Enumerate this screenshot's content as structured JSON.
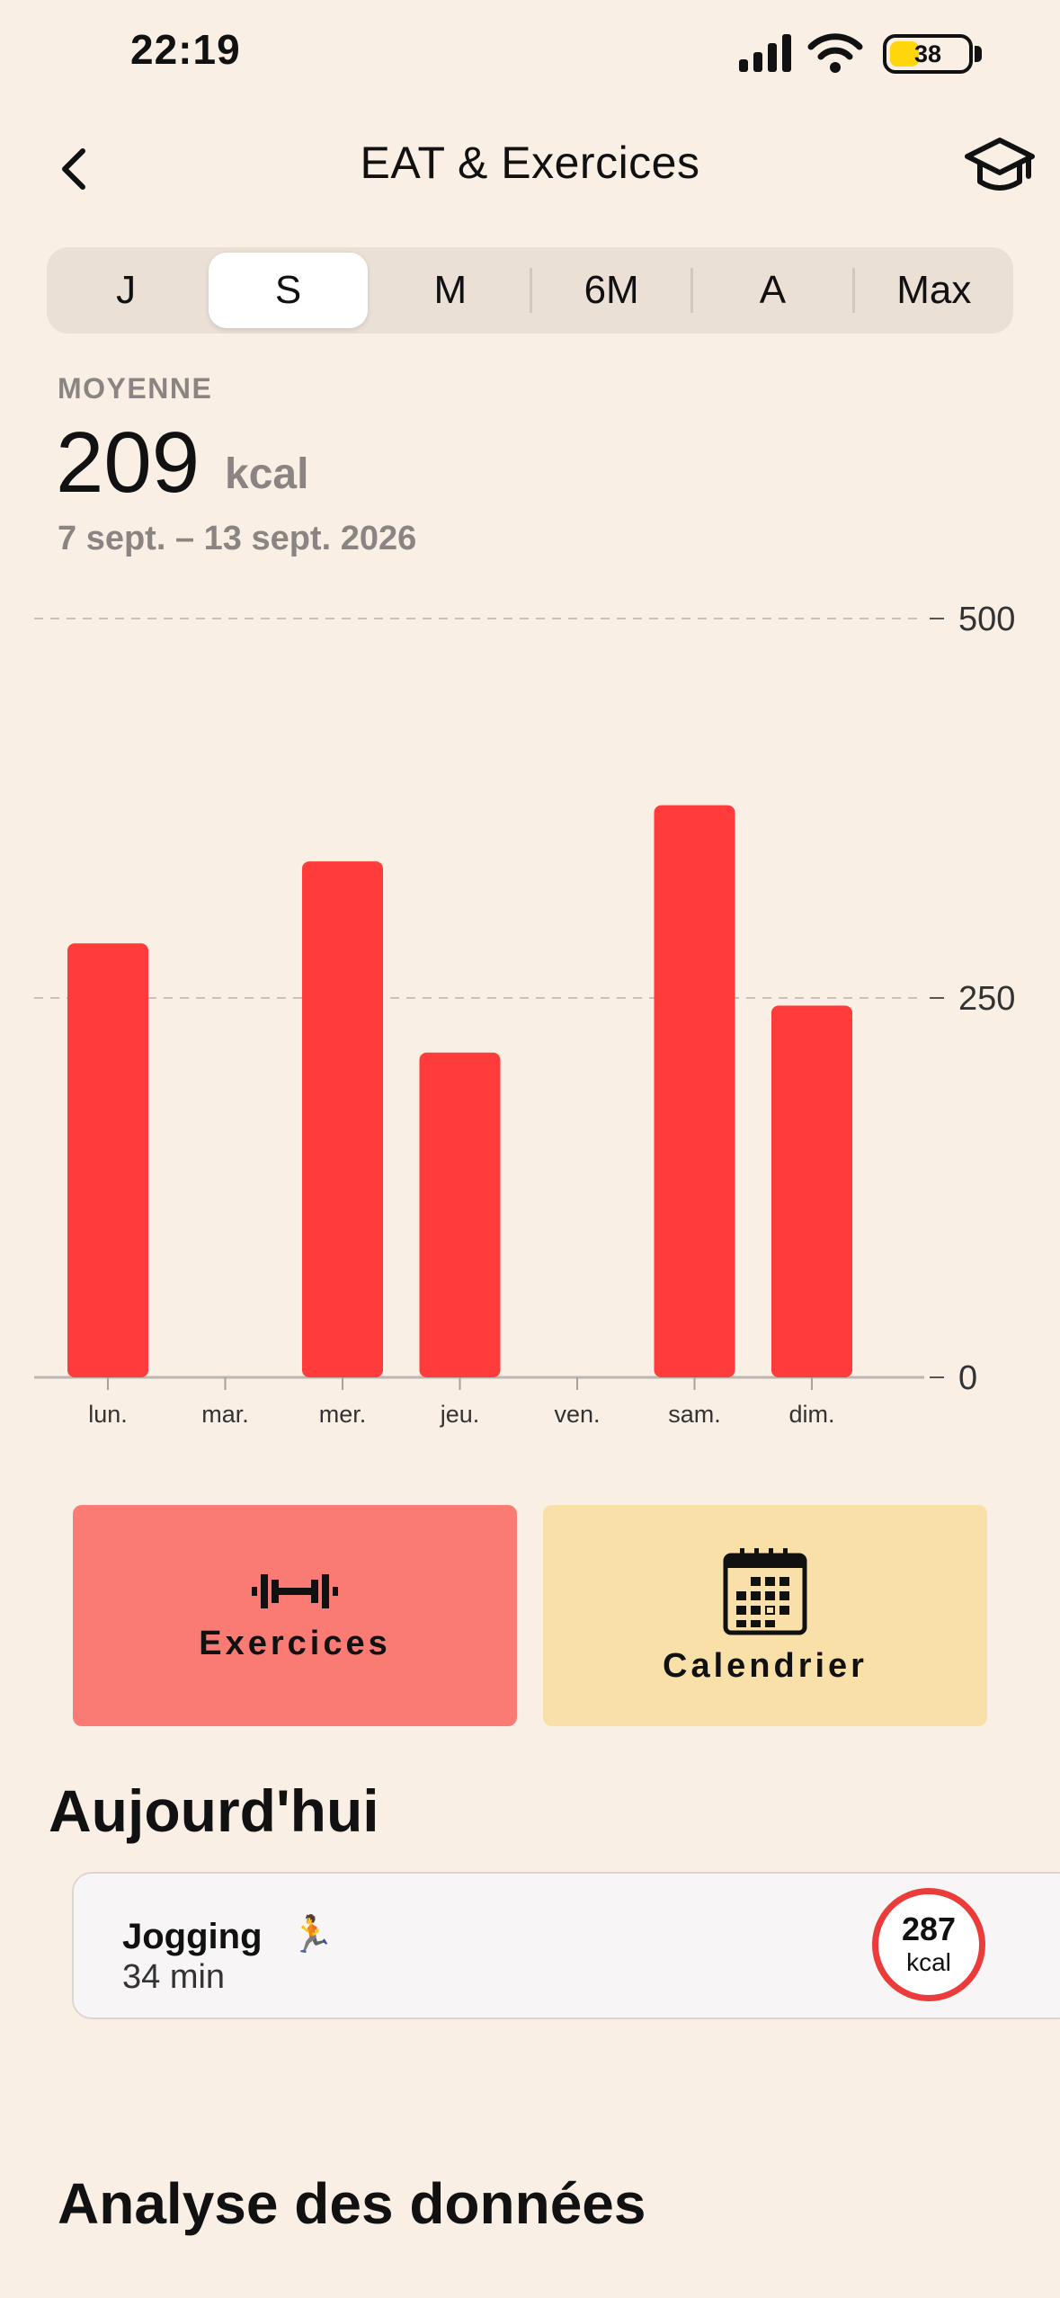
{
  "status_bar": {
    "time": "22:19",
    "battery": "38",
    "battery_level": 0.38
  },
  "header": {
    "title": "EAT & Exercices",
    "back_icon": "chevron-left-icon",
    "learn_icon": "graduation-cap-icon"
  },
  "segments": {
    "items": [
      "J",
      "S",
      "M",
      "6M",
      "A",
      "Max"
    ],
    "selected": "S"
  },
  "summary": {
    "label": "MOYENNE",
    "value": "209",
    "unit": "kcal",
    "range": "7 sept. – 13 sept. 2026"
  },
  "chart_data": {
    "type": "bar",
    "categories": [
      "lun.",
      "mar.",
      "mer.",
      "jeu.",
      "ven.",
      "sam.",
      "dim."
    ],
    "values": [
      286,
      0,
      340,
      214,
      0,
      377,
      245
    ],
    "ylim": [
      0,
      500
    ],
    "yticks": [
      "0",
      "250",
      "500"
    ],
    "grid": true,
    "color": "#FF3B3B"
  },
  "tiles": [
    {
      "label": "Exercices",
      "icon": "dumbbell-icon",
      "color": "#F97B73"
    },
    {
      "label": "Calendrier",
      "icon": "calendar-icon",
      "color": "#F9E0A8"
    }
  ],
  "today": {
    "title": "Aujourd'hui",
    "activity": {
      "name": "Jogging",
      "emoji": "🏃",
      "duration": "34 min",
      "kcal": "287",
      "kcal_unit": "kcal"
    }
  },
  "analysis": {
    "title": "Analyse des données"
  }
}
